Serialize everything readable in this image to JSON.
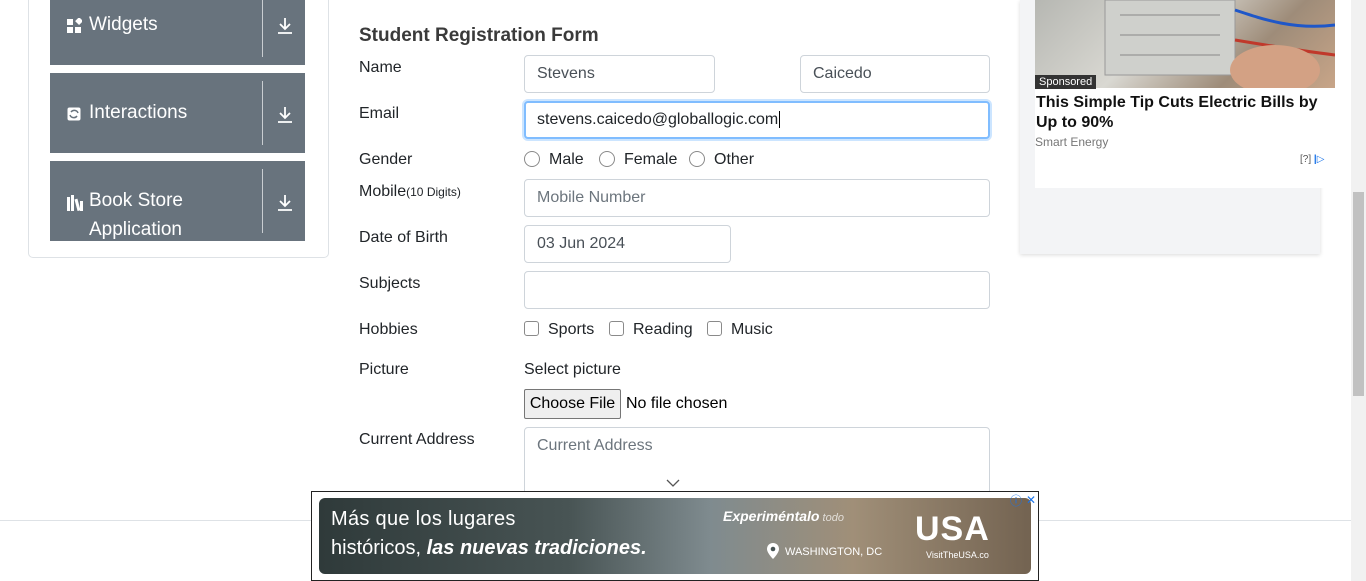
{
  "sidebar": {
    "groups": [
      {
        "label": "Widgets",
        "icon": "widgets-icon"
      },
      {
        "label": "Interactions",
        "icon": "interactions-icon"
      },
      {
        "label_line1": "Book Store",
        "label_line2": "Application",
        "icon": "book-store-icon"
      }
    ]
  },
  "form": {
    "title": "Student Registration Form",
    "name_label": "Name",
    "first_name_value": "Stevens",
    "last_name_value": "Caicedo",
    "email_label": "Email",
    "email_value": "stevens.caicedo@globallogic.com",
    "gender_label": "Gender",
    "gender_options": [
      "Male",
      "Female",
      "Other"
    ],
    "mobile_label": "Mobile",
    "mobile_hint": "(10 Digits)",
    "mobile_placeholder": "Mobile Number",
    "dob_label": "Date of Birth",
    "dob_value": "03 Jun 2024",
    "subjects_label": "Subjects",
    "hobbies_label": "Hobbies",
    "hobby_options": [
      "Sports",
      "Reading",
      "Music"
    ],
    "picture_label": "Picture",
    "select_picture": "Select picture",
    "choose_file": "Choose File",
    "no_file": "No file chosen",
    "address_label": "Current Address",
    "address_placeholder": "Current Address"
  },
  "side_ad": {
    "sponsored": "Sponsored",
    "title": "This Simple Tip Cuts Electric Bills by Up to 90%",
    "brand": "Smart Energy",
    "info": "[?]"
  },
  "bottom_ad": {
    "line1": "Más que los lugares",
    "line2_plain": "históricos, ",
    "line2_bold": "las nuevas tradiciones.",
    "experience": "Experiméntalo",
    "experience_suffix": " todo",
    "location": "WASHINGTON, DC",
    "logo": "USA",
    "visit": "VisitTheUSA.co"
  },
  "colors": {
    "sidebar_bg": "#68737d",
    "focus_border": "#80bdff"
  }
}
